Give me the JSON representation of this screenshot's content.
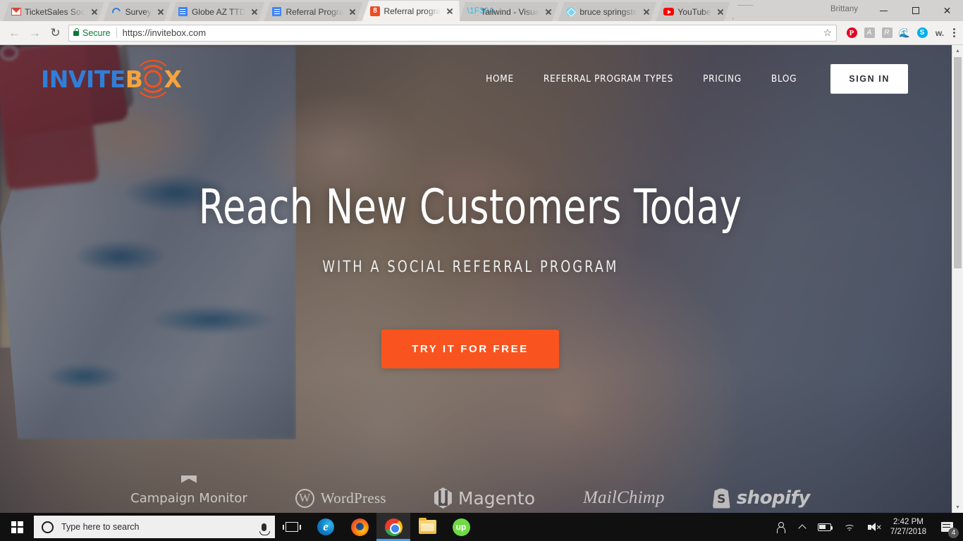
{
  "browser": {
    "tabs": [
      {
        "label": "TicketSales Soc",
        "icon": "gmail-icon",
        "active": false
      },
      {
        "label": "Survey",
        "icon": "loading-spinner-icon",
        "active": false
      },
      {
        "label": "Globe AZ TTD",
        "icon": "google-docs-icon",
        "active": false
      },
      {
        "label": "Referral Progra",
        "icon": "google-docs-icon",
        "active": false
      },
      {
        "label": "Referral progra",
        "icon": "invitebox-icon",
        "active": true
      },
      {
        "label": "Tailwind - Visua",
        "icon": "tailwind-icon",
        "active": false
      },
      {
        "label": "bruce springste",
        "icon": "evernote-icon",
        "active": false
      },
      {
        "label": "YouTube",
        "icon": "youtube-icon",
        "active": false
      }
    ],
    "new_tab_label": "",
    "profile_name": "Brittany",
    "window_controls": {
      "minimize": "minimize-icon",
      "maximize": "maximize-icon",
      "close": "close-icon"
    },
    "toolbar": {
      "back": "←",
      "forward": "→",
      "reload": "↻",
      "security_label": "Secure",
      "url": "https://invitebox.com",
      "bookmark": "☆",
      "extensions": [
        {
          "name": "pinterest-extension-icon",
          "glyph": "P"
        },
        {
          "name": "adobe-acrobat-extension-icon",
          "glyph": "A"
        },
        {
          "name": "grammarly-extension-icon",
          "glyph": "R"
        },
        {
          "name": "tailwind-extension-icon",
          "glyph": "ᴧ"
        },
        {
          "name": "skype-extension-icon",
          "glyph": "S"
        },
        {
          "name": "wordtune-extension-icon",
          "glyph": "w."
        }
      ],
      "menu": "chrome-menu-icon"
    },
    "scrollbar": {
      "up": "▲",
      "down": "▼"
    }
  },
  "site": {
    "logo": {
      "part1": "INVITE",
      "part2": "B",
      "part3": "O",
      "part4": "X"
    },
    "nav": [
      {
        "label": "HOME"
      },
      {
        "label": "REFERRAL PROGRAM TYPES"
      },
      {
        "label": "PRICING"
      },
      {
        "label": "BLOG"
      }
    ],
    "sign_in_label": "SIGN IN",
    "hero": {
      "headline": "Reach New Customers Today",
      "subheadline": "WITH A SOCIAL REFERRAL PROGRAM",
      "cta_label": "TRY IT FOR FREE"
    },
    "partners": [
      {
        "name": "Campaign Monitor"
      },
      {
        "name": "WordPress",
        "mark": "W"
      },
      {
        "name": "Magento"
      },
      {
        "name": "MailChimp"
      },
      {
        "name": "shopify",
        "mark": "S"
      }
    ],
    "colors": {
      "cta_orange": "#f9541f",
      "logo_blue": "#2f7fd8",
      "logo_orange": "#f7a33c",
      "logo_ring": "#f4511e"
    }
  },
  "taskbar": {
    "start": "windows-start-icon",
    "search_placeholder": "Type here to search",
    "mic": "microphone-icon",
    "task_view": "task-view-icon",
    "apps": [
      {
        "name": "microsoft-edge-taskbar-icon",
        "glyph": "e",
        "active": false
      },
      {
        "name": "firefox-taskbar-icon",
        "glyph": "",
        "active": false
      },
      {
        "name": "google-chrome-taskbar-icon",
        "glyph": "",
        "active": true
      },
      {
        "name": "file-explorer-taskbar-icon",
        "glyph": "",
        "active": false
      },
      {
        "name": "upwork-taskbar-icon",
        "glyph": "up",
        "active": false
      }
    ],
    "tray": {
      "people": "people-icon",
      "show_hidden": "show-hidden-icons-icon",
      "battery": "battery-icon",
      "network": "wifi-icon",
      "volume": "volume-muted-icon",
      "time": "2:42 PM",
      "date": "7/27/2018",
      "notification_count": "4"
    }
  }
}
